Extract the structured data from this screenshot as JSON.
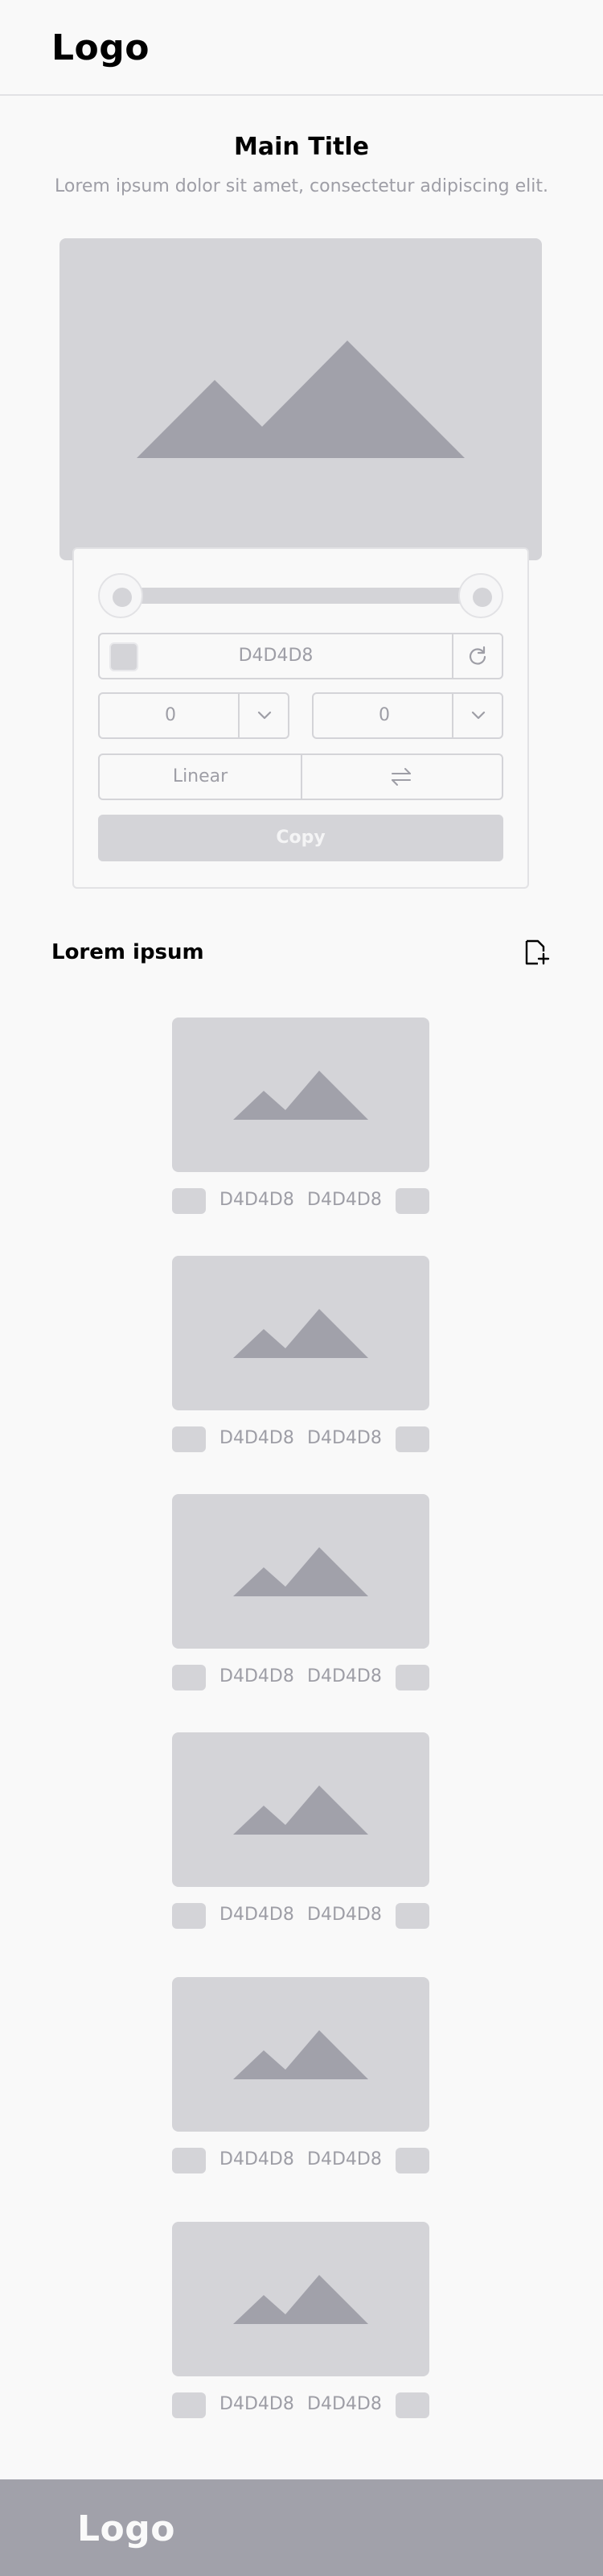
{
  "header": {
    "logo": "Logo"
  },
  "hero": {
    "title": "Main Title",
    "subtitle": "Lorem ipsum dolor sit amet, consectetur adipiscing elit."
  },
  "controls": {
    "color_hex": "D4D4D8",
    "start_value": "0",
    "end_value": "0",
    "mode_label": "Linear",
    "copy_label": "Copy",
    "icons": [
      "refresh-icon",
      "chevron-down-icon",
      "swap-arrows-icon"
    ]
  },
  "section": {
    "title": "Lorem ipsum",
    "action_icon": "file-plus-icon"
  },
  "gallery": [
    {
      "color_a": "D4D4D8",
      "color_b": "D4D4D8"
    },
    {
      "color_a": "D4D4D8",
      "color_b": "D4D4D8"
    },
    {
      "color_a": "D4D4D8",
      "color_b": "D4D4D8"
    },
    {
      "color_a": "D4D4D8",
      "color_b": "D4D4D8"
    },
    {
      "color_a": "D4D4D8",
      "color_b": "D4D4D8"
    },
    {
      "color_a": "D4D4D8",
      "color_b": "D4D4D8"
    }
  ],
  "footer": {
    "logo": "Logo"
  },
  "colors": {
    "background": "#f9f9f9",
    "placeholder": "#d4d4d8",
    "placeholder_shape": "#a1a1aa",
    "muted_text": "#9e9ea6",
    "footer": "#a1a1aa"
  }
}
